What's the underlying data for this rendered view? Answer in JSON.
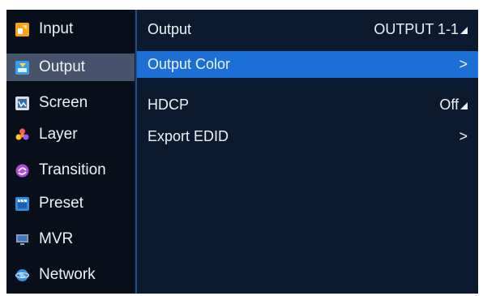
{
  "sidebar": {
    "items": [
      {
        "label": "Input",
        "icon": "input-icon"
      },
      {
        "label": "Output",
        "icon": "output-icon"
      },
      {
        "label": "Screen",
        "icon": "screen-icon"
      },
      {
        "label": "Layer",
        "icon": "layer-icon"
      },
      {
        "label": "Transition",
        "icon": "transition-icon"
      },
      {
        "label": "Preset",
        "icon": "preset-icon"
      },
      {
        "label": "MVR",
        "icon": "mvr-icon"
      },
      {
        "label": "Network",
        "icon": "network-icon"
      }
    ],
    "selected": "Output"
  },
  "main": {
    "rows": [
      {
        "label": "Output",
        "value": "OUTPUT 1-1",
        "control": "dropdown"
      },
      {
        "label": "Output Color",
        "value": ">",
        "control": "submenu"
      },
      {
        "label": "HDCP",
        "value": "Off",
        "control": "dropdown"
      },
      {
        "label": "Export EDID",
        "value": ">",
        "control": "submenu"
      }
    ],
    "highlighted": "Output Color"
  },
  "colors": {
    "background": "#0b1a2e",
    "sidebar": "#080f1b",
    "selected_sidebar": "#46536a",
    "highlight": "#1b6fd6",
    "border": "#1f4e86"
  }
}
